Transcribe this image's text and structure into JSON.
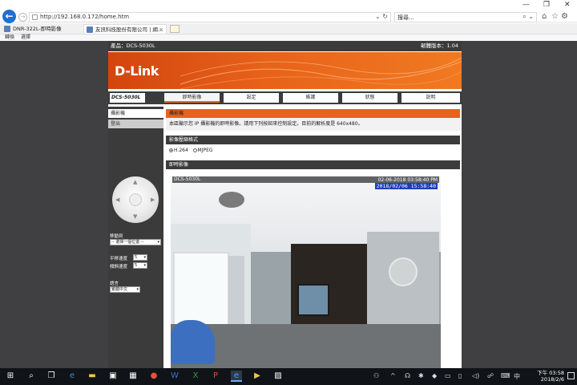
{
  "browser": {
    "url": "http://192.168.0.172/home.htm",
    "search_placeholder": "搜尋...",
    "tabs": [
      {
        "label": "DNR-322L-即時影像"
      },
      {
        "label": "友訊科技股份有限公司 | 網..."
      }
    ],
    "favorites": [
      "轉換",
      "選擇"
    ],
    "window_controls": [
      "—",
      "❐",
      "✕"
    ]
  },
  "page": {
    "model_label": "產品：DCS-5030L",
    "firmware_label": "韌體版本：1.04",
    "logo": "D-Link",
    "product_badge": "DCS-5030L",
    "nav_tabs": [
      "即時影像",
      "設定",
      "維護",
      "狀態",
      "說明"
    ],
    "sidebar": {
      "items": [
        "攝影機",
        "登出"
      ],
      "move_label": "移動到",
      "move_value": "-- 選擇一個位置 --",
      "pan_label": "平移速度",
      "pan_value": "5",
      "tilt_label": "傾斜速度",
      "tilt_value": "5",
      "lang_label": "語言",
      "lang_value": "繁體中文"
    },
    "camera_section": {
      "title": "攝影機",
      "description": "本區顯示您 IP 攝影機的即時影像。請用下列按鈕來控制設定。目前的解析度是 640x480。"
    },
    "codec_section": {
      "title": "影像壓縮格式",
      "options": [
        "H.264",
        "MJPEG"
      ],
      "selected": "H.264"
    },
    "live_section": {
      "title": "即時影像",
      "cam_name": "DCS-5030L",
      "cam_timestamp": "02-06-2018 03:58:40 PM",
      "osd_timestamp": "2018/02/06 15:58:40"
    }
  },
  "taskbar": {
    "time": "下午 03:58",
    "date": "2018/2/6"
  }
}
